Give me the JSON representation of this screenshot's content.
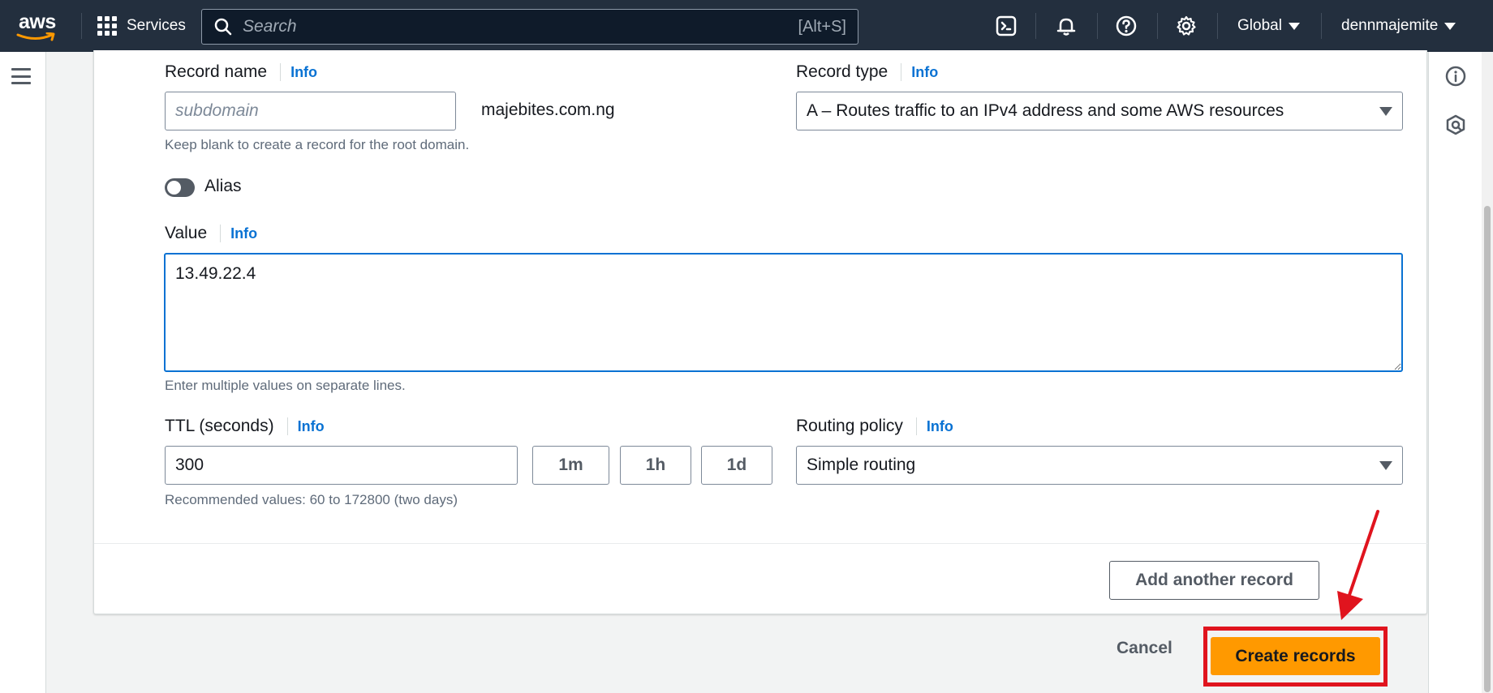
{
  "topnav": {
    "services_label": "Services",
    "search_placeholder": "Search",
    "search_shortcut": "[Alt+S]",
    "region_label": "Global",
    "account_label": "dennmajemite"
  },
  "form": {
    "record_name": {
      "label": "Record name",
      "info": "Info",
      "placeholder": "subdomain",
      "domain_suffix": "majebites.com.ng",
      "hint": "Keep blank to create a record for the root domain."
    },
    "record_type": {
      "label": "Record type",
      "info": "Info",
      "value": "A – Routes traffic to an IPv4 address and some AWS resources"
    },
    "alias": {
      "label": "Alias",
      "enabled": false
    },
    "value": {
      "label": "Value",
      "info": "Info",
      "text": "13.49.22.4",
      "hint": "Enter multiple values on separate lines."
    },
    "ttl": {
      "label": "TTL (seconds)",
      "info": "Info",
      "value": "300",
      "preset_1m": "1m",
      "preset_1h": "1h",
      "preset_1d": "1d",
      "hint": "Recommended values: 60 to 172800 (two days)"
    },
    "routing_policy": {
      "label": "Routing policy",
      "info": "Info",
      "value": "Simple routing"
    },
    "add_another_label": "Add another record"
  },
  "footer": {
    "cancel_label": "Cancel",
    "create_label": "Create records"
  },
  "colors": {
    "nav_bg": "#232f3e",
    "link_blue": "#0972d3",
    "primary_orange": "#ff9900",
    "annotation_red": "#e0141e"
  }
}
